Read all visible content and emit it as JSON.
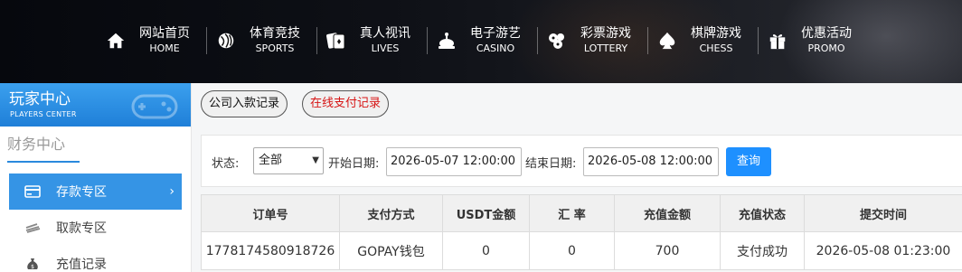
{
  "nav": {
    "items": [
      {
        "cn": "网站首页",
        "en": "HOME",
        "icon": "home-icon"
      },
      {
        "cn": "体育竞技",
        "en": "SPORTS",
        "icon": "ball-icon"
      },
      {
        "cn": "真人视讯",
        "en": "LIVES",
        "icon": "cards-icon"
      },
      {
        "cn": "电子游艺",
        "en": "CASINO",
        "icon": "slot-icon"
      },
      {
        "cn": "彩票游戏",
        "en": "LOTTERY",
        "icon": "lottery-balls-icon"
      },
      {
        "cn": "棋牌游戏",
        "en": "CHESS",
        "icon": "spade-icon"
      },
      {
        "cn": "优惠活动",
        "en": "PROMO",
        "icon": "gift-icon"
      }
    ]
  },
  "sidebar": {
    "header_cn": "玩家中心",
    "header_en": "PLAYERS CENTER",
    "section_title": "财务中心",
    "items": [
      {
        "label": "存款专区",
        "icon": "card-icon",
        "active": true
      },
      {
        "label": "取款专区",
        "icon": "cash-icon",
        "active": false
      },
      {
        "label": "充值记录",
        "icon": "money-bag-icon",
        "active": false
      }
    ],
    "active_color": "#3594e5"
  },
  "tabs": {
    "company": "公司入款记录",
    "online": "在线支付记录"
  },
  "filter": {
    "status_label": "状态:",
    "status_value": "全部",
    "start_label": "开始日期:",
    "start_value": "2026-05-07 12:00:00",
    "end_label": "结束日期:",
    "end_value": "2026-05-08 12:00:00",
    "query_button": "查询"
  },
  "table": {
    "headers": [
      "订单号",
      "支付方式",
      "USDT金额",
      "汇 率",
      "充值金额",
      "充值状态",
      "提交时间"
    ],
    "rows": [
      [
        "1778174580918726",
        "GOPAY钱包",
        "0",
        "0",
        "700",
        "支付成功",
        "2026-05-08 01:23:00"
      ]
    ]
  },
  "colors": {
    "primary": "#1e90ff",
    "tab_red": "#d71515"
  }
}
